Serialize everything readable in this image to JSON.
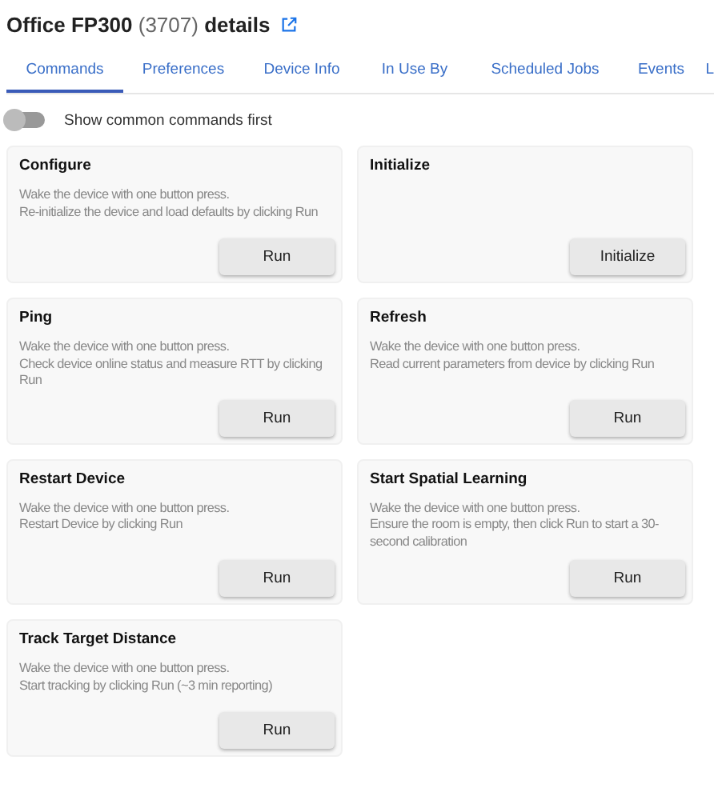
{
  "header": {
    "title": "Office FP300",
    "id": "(3707)",
    "suffix": "details"
  },
  "tabs": [
    {
      "label": "Commands",
      "selected": true
    },
    {
      "label": "Preferences",
      "selected": false
    },
    {
      "label": "Device Info",
      "selected": false
    },
    {
      "label": "In Use By",
      "selected": false
    },
    {
      "label": "Scheduled Jobs",
      "selected": false
    },
    {
      "label": "Events",
      "selected": false
    },
    {
      "label": "L",
      "selected": false
    }
  ],
  "toggle": {
    "label": "Show common commands first",
    "on": false
  },
  "commands": [
    {
      "name": "Configure",
      "lines": [
        "Wake the device with one button press.",
        "Re-initialize the device and load defaults by clicking Run"
      ],
      "button": "Run"
    },
    {
      "name": "Initialize",
      "button": "Initialize"
    },
    {
      "name": "Ping",
      "lines": [
        "Wake the device with one button press.",
        "Check device online status and measure RTT by clicking Run"
      ],
      "button": "Run"
    },
    {
      "name": "Refresh",
      "lines": [
        "Wake the device with one button press.",
        "Read current parameters from device by clicking Run"
      ],
      "button": "Run"
    },
    {
      "name": "Restart Device",
      "lines": [
        "Wake the device with one button press.",
        "Restart Device by clicking Run"
      ],
      "button": "Run"
    },
    {
      "name": "Start Spatial Learning",
      "lines": [
        "Wake the device with one button press.",
        "Ensure the room is empty, then click Run to start a 30-second calibration"
      ],
      "button": "Run"
    },
    {
      "name": "Track Target Distance",
      "lines": [
        "Wake the device with one button press.",
        "Start tracking by clicking Run (~3 min reporting)"
      ],
      "button": "Run"
    }
  ]
}
